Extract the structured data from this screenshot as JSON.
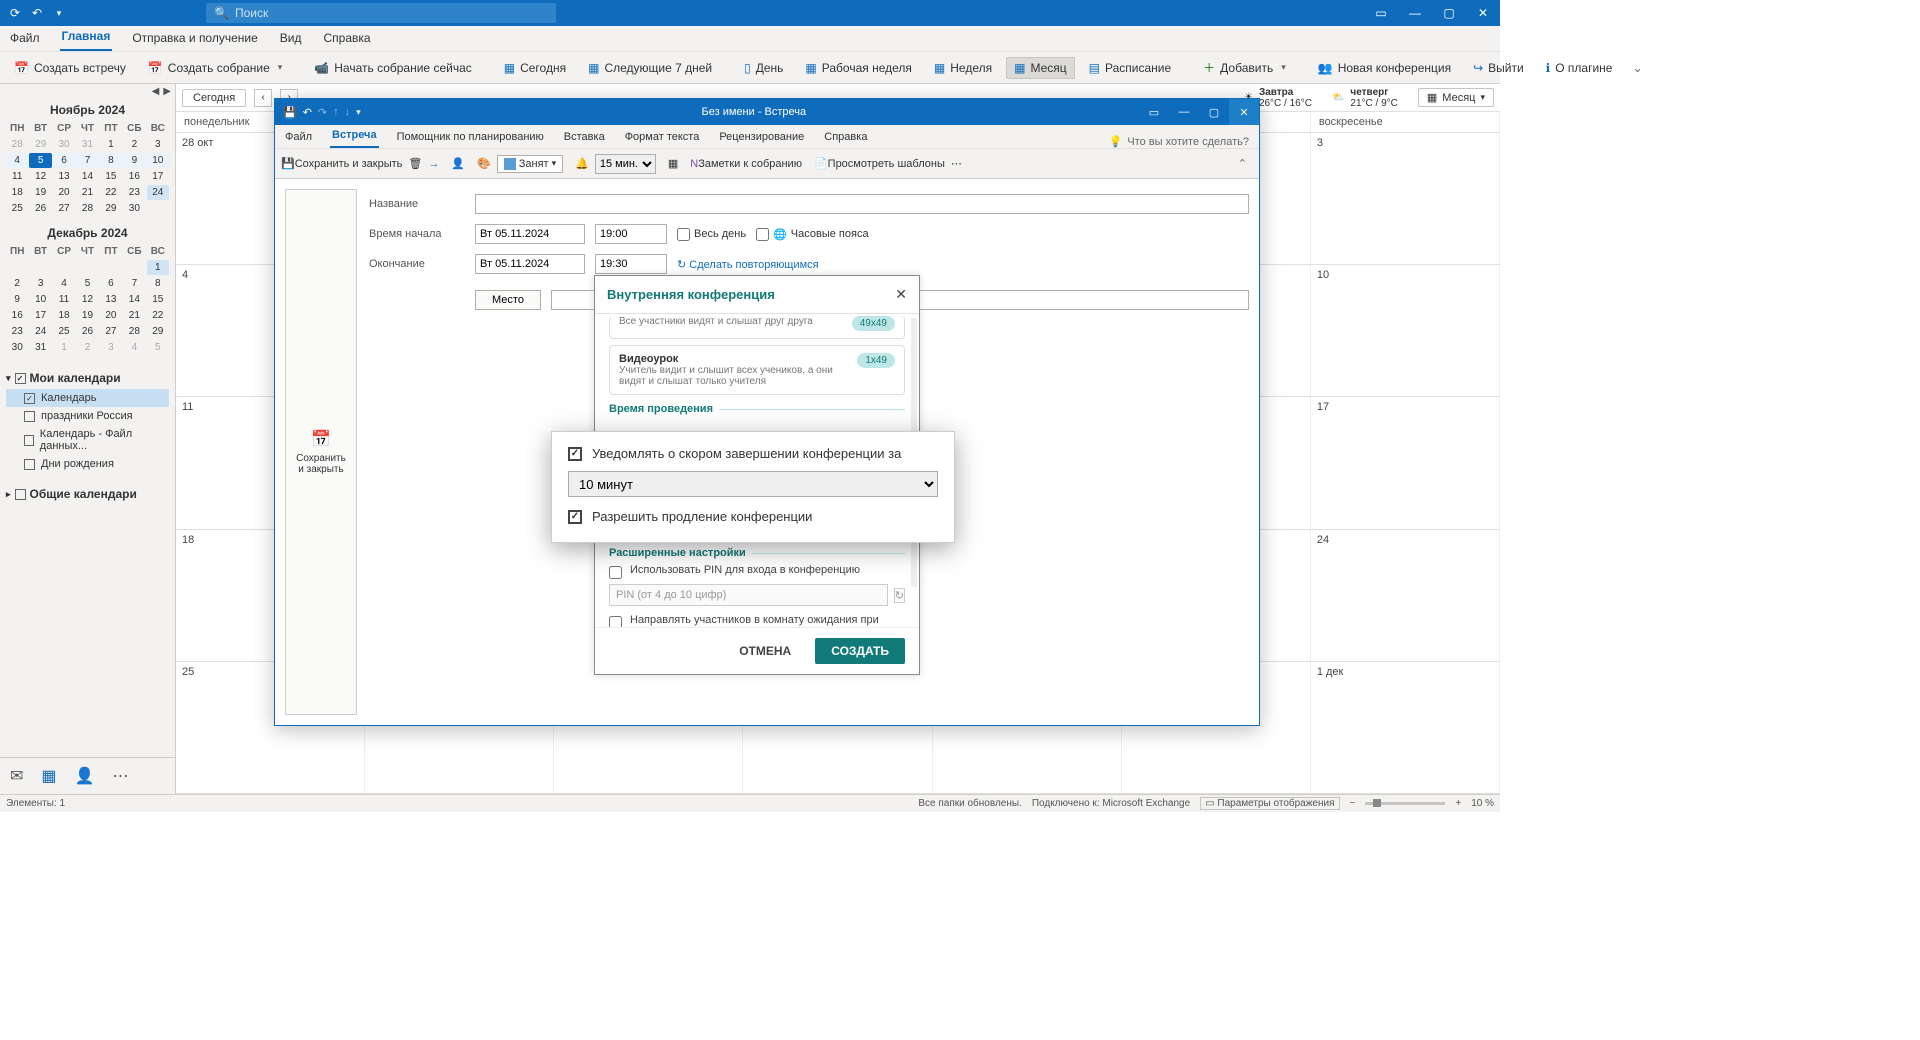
{
  "titlebar": {
    "search_placeholder": "Поиск"
  },
  "menutabs": [
    "Файл",
    "Главная",
    "Отправка и получение",
    "Вид",
    "Справка"
  ],
  "ribbon": {
    "create_meeting": "Создать встречу",
    "create_assembly": "Создать собрание",
    "start_assembly_now": "Начать собрание сейчас",
    "today": "Сегодня",
    "next7": "Следующие 7 дней",
    "day": "День",
    "workweek": "Рабочая неделя",
    "week": "Неделя",
    "month": "Месяц",
    "schedule": "Расписание",
    "add": "Добавить",
    "new_conf": "Новая конференция",
    "logout": "Выйти",
    "about": "О плагине"
  },
  "minicals": {
    "nov": {
      "title": "Ноябрь 2024",
      "dow": [
        "ПН",
        "ВТ",
        "СР",
        "ЧТ",
        "ПТ",
        "СБ",
        "ВС"
      ],
      "cells": [
        {
          "n": "28",
          "g": 1
        },
        {
          "n": "29",
          "g": 1
        },
        {
          "n": "30",
          "g": 1
        },
        {
          "n": "31",
          "g": 1
        },
        {
          "n": "1"
        },
        {
          "n": "2"
        },
        {
          "n": "3"
        },
        {
          "n": "4",
          "sr": 1
        },
        {
          "n": "5",
          "today": 1
        },
        {
          "n": "6",
          "sr": 1
        },
        {
          "n": "7",
          "sr": 1
        },
        {
          "n": "8",
          "sr": 1
        },
        {
          "n": "9",
          "sr": 1
        },
        {
          "n": "10",
          "sr": 1
        },
        {
          "n": "11"
        },
        {
          "n": "12"
        },
        {
          "n": "13"
        },
        {
          "n": "14"
        },
        {
          "n": "15"
        },
        {
          "n": "16"
        },
        {
          "n": "17"
        },
        {
          "n": "18"
        },
        {
          "n": "19"
        },
        {
          "n": "20"
        },
        {
          "n": "21"
        },
        {
          "n": "22"
        },
        {
          "n": "23"
        },
        {
          "n": "24",
          "sel": 1
        },
        {
          "n": "25"
        },
        {
          "n": "26"
        },
        {
          "n": "27"
        },
        {
          "n": "28"
        },
        {
          "n": "29"
        },
        {
          "n": "30"
        },
        {
          "n": ""
        }
      ]
    },
    "dec": {
      "title": "Декабрь 2024",
      "dow": [
        "ПН",
        "ВТ",
        "СР",
        "ЧТ",
        "ПТ",
        "СБ",
        "ВС"
      ],
      "cells": [
        {
          "n": ""
        },
        {
          "n": ""
        },
        {
          "n": ""
        },
        {
          "n": ""
        },
        {
          "n": ""
        },
        {
          "n": ""
        },
        {
          "n": "1",
          "sel": 1
        },
        {
          "n": "2"
        },
        {
          "n": "3"
        },
        {
          "n": "4"
        },
        {
          "n": "5"
        },
        {
          "n": "6"
        },
        {
          "n": "7"
        },
        {
          "n": "8"
        },
        {
          "n": "9"
        },
        {
          "n": "10"
        },
        {
          "n": "11"
        },
        {
          "n": "12"
        },
        {
          "n": "13"
        },
        {
          "n": "14"
        },
        {
          "n": "15"
        },
        {
          "n": "16"
        },
        {
          "n": "17"
        },
        {
          "n": "18"
        },
        {
          "n": "19"
        },
        {
          "n": "20"
        },
        {
          "n": "21"
        },
        {
          "n": "22"
        },
        {
          "n": "23"
        },
        {
          "n": "24"
        },
        {
          "n": "25"
        },
        {
          "n": "26"
        },
        {
          "n": "27"
        },
        {
          "n": "28"
        },
        {
          "n": "29"
        },
        {
          "n": "30"
        },
        {
          "n": "31"
        },
        {
          "n": "1",
          "g": 1
        },
        {
          "n": "2",
          "g": 1
        },
        {
          "n": "3",
          "g": 1
        },
        {
          "n": "4",
          "g": 1
        },
        {
          "n": "5",
          "g": 1
        }
      ]
    }
  },
  "cal_list": {
    "my_calendars": "Мои календари",
    "items": [
      "Календарь",
      "праздники Россия",
      "Календарь - Файл данных...",
      "Дни рождения"
    ],
    "shared_calendars": "Общие календари"
  },
  "calhdr": {
    "today": "Сегодня",
    "tomorrow_label": "Завтра",
    "tomorrow_temp": "26°C / 16°C",
    "thursday_label": "четверг",
    "thursday_temp": "21°C / 9°C",
    "viewsel": "Месяц"
  },
  "dayheader": [
    "понедельник",
    "",
    "",
    "",
    "",
    "",
    "воскресенье"
  ],
  "weekcells": [
    [
      "28 окт",
      "",
      "",
      "",
      "",
      "",
      "3"
    ],
    [
      "4",
      "",
      "",
      "",
      "",
      "",
      "10"
    ],
    [
      "11",
      "",
      "",
      "",
      "",
      "",
      "17"
    ],
    [
      "18",
      "",
      "",
      "",
      "",
      "",
      "24"
    ],
    [
      "25",
      "",
      "",
      "",
      "",
      "",
      "1 дек"
    ]
  ],
  "meeting": {
    "title": "Без имени  -  Встреча",
    "tabs": [
      "Файл",
      "Встреча",
      "Помощник по планированию",
      "Вставка",
      "Формат текста",
      "Рецензирование",
      "Справка"
    ],
    "tell": "Что вы хотите сделать?",
    "ribbon": {
      "save_close": "Сохранить и закрыть",
      "busy": "Занят",
      "reminder": "15 мин.",
      "notes": "Заметки к собранию",
      "templates": "Просмотреть шаблоны"
    },
    "save_block": "Сохранить\nи закрыть",
    "labels": {
      "name": "Название",
      "start": "Время начала",
      "end": "Окончание",
      "place": "Место"
    },
    "date": "Вт 05.11.2024",
    "start_time": "19:00",
    "end_time": "19:30",
    "allday": "Весь день",
    "timezones": "Часовые пояса",
    "recurring": "Сделать повторяющимся"
  },
  "conf": {
    "title": "Внутренняя конференция",
    "card1_desc": "Все участники видят и слышат друг друга",
    "card1_badge": "49x49",
    "card2_title": "Видеоурок",
    "card2_desc": "Учитель видит и слышит всех учеников, а они видят и слышат только учителя",
    "card2_badge": "1x49",
    "section1": "Время проведения",
    "section2": "Расширенные настройки",
    "pin_label": "Использовать PIN для входа в конференцию",
    "pin_placeholder": "PIN (от 4 до 10 цифр)",
    "waitroom": "Направлять участников в комнату ожидания при входе",
    "cancel": "ОТМЕНА",
    "create": "СОЗДАТЬ"
  },
  "popover": {
    "notify": "Уведомлять о скором завершении конференции за",
    "value": "10 минут",
    "allow_extend": "Разрешить продление конференции"
  },
  "status": {
    "elements": "Элементы: 1",
    "folders": "Все папки обновлены.",
    "connected": "Подключено к: Microsoft Exchange",
    "display_params": "Параметры отображения",
    "zoom": "10 %"
  }
}
